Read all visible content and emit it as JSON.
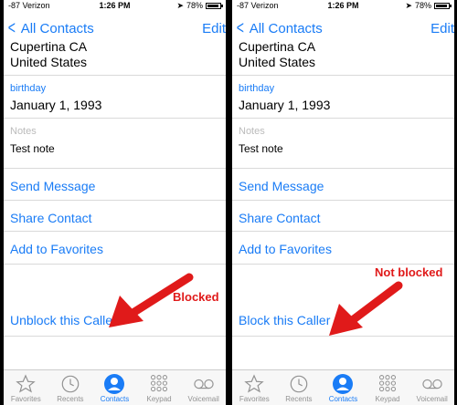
{
  "panels": {
    "left": {
      "status": {
        "carrier": "-87 Verizon",
        "time": "1:26 PM",
        "battery_text": "78%",
        "battery_level": 0.78
      },
      "nav": {
        "back_label": "All Contacts",
        "edit_label": "Edit"
      },
      "address": {
        "line1": "Cupertina CA",
        "line2": "United States"
      },
      "birthday": {
        "label": "birthday",
        "value": "January 1, 1993"
      },
      "notes": {
        "label": "Notes",
        "value": "Test note"
      },
      "actions": {
        "send_message": "Send Message",
        "share_contact": "Share Contact",
        "add_favorites": "Add to Favorites",
        "block_toggle": "Unblock this Caller"
      },
      "annotation": "Blocked",
      "tabs": [
        {
          "label": "Favorites",
          "icon": "star-icon",
          "active": false
        },
        {
          "label": "Recents",
          "icon": "clock-icon",
          "active": false
        },
        {
          "label": "Contacts",
          "icon": "person-icon",
          "active": true
        },
        {
          "label": "Keypad",
          "icon": "keypad-icon",
          "active": false
        },
        {
          "label": "Voicemail",
          "icon": "voicemail-icon",
          "active": false
        }
      ]
    },
    "right": {
      "status": {
        "carrier": "-87 Verizon",
        "time": "1:26 PM",
        "battery_text": "78%",
        "battery_level": 0.78
      },
      "nav": {
        "back_label": "All Contacts",
        "edit_label": "Edit"
      },
      "address": {
        "line1": "Cupertina CA",
        "line2": "United States"
      },
      "birthday": {
        "label": "birthday",
        "value": "January 1, 1993"
      },
      "notes": {
        "label": "Notes",
        "value": "Test note"
      },
      "actions": {
        "send_message": "Send Message",
        "share_contact": "Share Contact",
        "add_favorites": "Add to Favorites",
        "block_toggle": "Block this Caller"
      },
      "annotation": "Not blocked",
      "tabs": [
        {
          "label": "Favorites",
          "icon": "star-icon",
          "active": false
        },
        {
          "label": "Recents",
          "icon": "clock-icon",
          "active": false
        },
        {
          "label": "Contacts",
          "icon": "person-icon",
          "active": true
        },
        {
          "label": "Keypad",
          "icon": "keypad-icon",
          "active": false
        },
        {
          "label": "Voicemail",
          "icon": "voicemail-icon",
          "active": false
        }
      ]
    }
  },
  "colors": {
    "accent": "#1a7cf6",
    "annotation": "#e01a1a",
    "tab_inactive": "#929292"
  }
}
